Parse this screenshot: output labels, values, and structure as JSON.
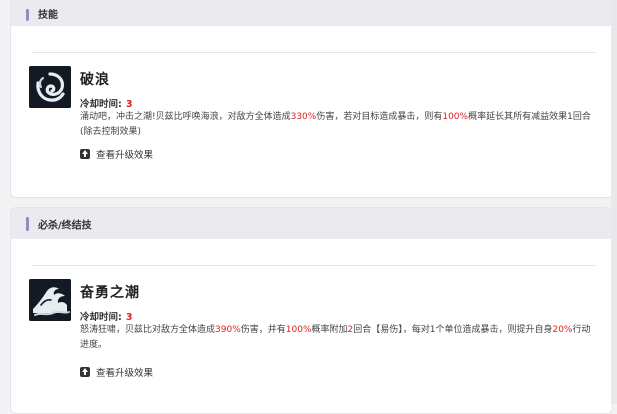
{
  "sections": [
    {
      "title": "技能",
      "skill": {
        "name": "破浪",
        "cooldown_label": "冷却时间:",
        "cooldown_value": "3",
        "desc_parts": [
          "涌动吧，冲击之潮!贝兹比呼唤海浪，对敌方全体造成",
          "330%",
          "伤害，若对目标造成暴击，则有",
          "100%",
          "概率延长其所有减益效果1回合(除去控制效果)"
        ],
        "upgrade_label": "查看升级效果",
        "icon": "wave-swirl-icon"
      }
    },
    {
      "title": "必杀/终结技",
      "skill": {
        "name": "奋勇之潮",
        "cooldown_label": "冷却时间:",
        "cooldown_value": "3",
        "desc_parts": [
          "怒涛狂啸，贝兹比对敌方全体造成",
          "390%",
          "伤害，并有",
          "100%",
          "概率附加",
          "2",
          "回合【易伤】，每对1个单位造成暴击，则提升自身",
          "20%",
          "行动进度。"
        ],
        "upgrade_label": "查看升级效果",
        "icon": "tidal-wave-icon"
      }
    }
  ],
  "colors": {
    "accent": "#8a8fc9",
    "highlight": "#e02020",
    "header_bg": "#ebebef"
  }
}
